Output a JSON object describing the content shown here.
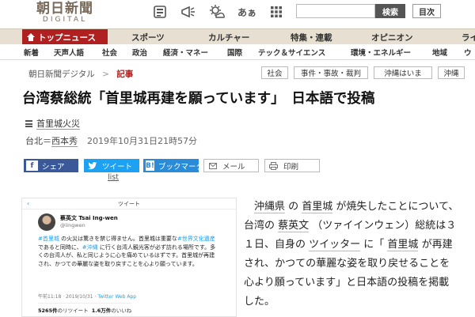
{
  "header": {
    "logo_main": "朝日新聞",
    "logo_sub": "DIGITAL",
    "icons": [
      "photo-icon",
      "megaphone-icon",
      "weather-icon",
      "font-size-icon",
      "grid-menu-icon"
    ],
    "font_size_glyph": "あぁ",
    "search_placeholder": "",
    "search_button": "検索",
    "toc_button": "目次"
  },
  "nav_primary": {
    "home": "トップニュース",
    "items": [
      "スポーツ",
      "カルチャー",
      "特集・連載",
      "オピニオン",
      "ライ"
    ]
  },
  "nav_secondary": {
    "items": [
      "新着",
      "天声人語",
      "社会",
      "政治",
      "経済・マネー",
      "国際",
      "テック＆サイエンス",
      "環境・エネルギー",
      "地域",
      "ウ"
    ]
  },
  "breadcrumb": {
    "site": "朝日新聞デジタル",
    "separator": ">",
    "current": "記事"
  },
  "tags": [
    "社会",
    "事件・事故・裁判",
    "沖縄はいま",
    "沖縄"
  ],
  "article": {
    "headline": "台湾蔡総統「首里城再建を願っています」　日本語で投稿",
    "related_topic": "首里城火災",
    "location": "台北",
    "byline_sep": "＝",
    "author": "西本秀",
    "date": "2019年10月31日21時57分"
  },
  "share": {
    "facebook": "シェア",
    "twitter": "ツイート",
    "hatena": "ブックマーク",
    "mail": "メール",
    "print": "印刷",
    "list": "list"
  },
  "tweet_image": {
    "top_label": "ツイート",
    "name": "蔡英文 Tsai Ing-wen",
    "handle": "@iingwen",
    "text_segments": [
      {
        "t": "#首里城",
        "hl": true
      },
      {
        "t": " の火災は驚きを禁じ得ません。首里城は重要な",
        "hl": false
      },
      {
        "t": "#世界文化遺産",
        "hl": true
      },
      {
        "t": " であると同時に、",
        "hl": false
      },
      {
        "t": "#沖縄",
        "hl": true
      },
      {
        "t": " に行く台湾人観光客が必ず訪れる場所です。多くの台湾人が、私と同じように心を痛めているはずです。首里城が再建され、かつての華麗な姿を取り戻すことを心より願っています。",
        "hl": false
      }
    ],
    "meta_time": "午前11:18 · 2019/10/31 · ",
    "meta_app": "Twitter Web App",
    "retweets": "5265件",
    "retweets_label": "のリツイート",
    "likes": "1.6万件",
    "likes_label": "のいいね"
  },
  "body": {
    "p1": "沖縄県",
    "p2": " の ",
    "p3": "首里城",
    "p4": " が焼失したことについて、台湾の ",
    "p5": "蔡英文",
    "p6": " （ツァイインウェン）総統は３１日、自身の ",
    "p7": "ツイッター",
    "p8": " に「 ",
    "p9": "首里城",
    "p10": " が再建され、かつての華麗な姿を取り戻せることを心より願っています」と日本語の投稿を掲載した。"
  }
}
